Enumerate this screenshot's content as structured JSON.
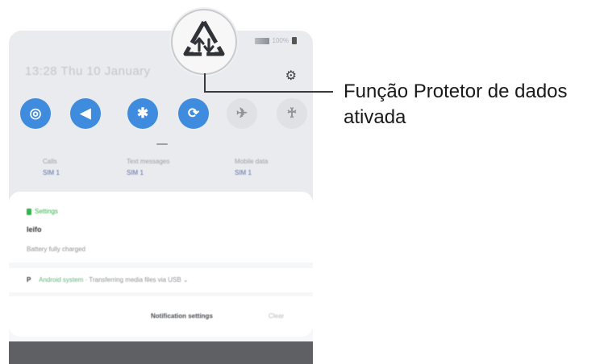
{
  "phone": {
    "status_percent": "100%",
    "datetime": "13:28 Thu 10 January",
    "quick_settings": [
      {
        "icon": "wifi-icon",
        "glyph": "◎",
        "state": "on"
      },
      {
        "icon": "sound-icon",
        "glyph": "◀",
        "state": "on"
      },
      {
        "icon": "bluetooth-icon",
        "glyph": "✱",
        "state": "on"
      },
      {
        "icon": "auto-rotate-icon",
        "glyph": "⟳",
        "state": "on"
      },
      {
        "icon": "airplane-mode-icon",
        "glyph": "✈",
        "state": "off"
      },
      {
        "icon": "flashlight-icon",
        "glyph": "♰",
        "state": "off"
      }
    ],
    "sims": [
      {
        "label": "Calls",
        "badge": "SIM 1"
      },
      {
        "label": "Text messages",
        "badge": "SIM 1"
      },
      {
        "label": "Mobile data",
        "badge": "SIM 1"
      }
    ],
    "notification": {
      "app": "Settings",
      "title": "Ieifo",
      "text": "Battery fully charged"
    },
    "system_notification": {
      "prefix": "P",
      "app": "Android system",
      "text": "· Transferring media files via USB ⌄"
    },
    "notification_settings": "Notification settings",
    "clear": "Clear"
  },
  "callout": {
    "text": "Função Protetor de dados ativada",
    "icon": "data-saver-icon"
  },
  "colors": {
    "accent_blue": "#3f8bdd",
    "settings_green": "#35b24a"
  }
}
